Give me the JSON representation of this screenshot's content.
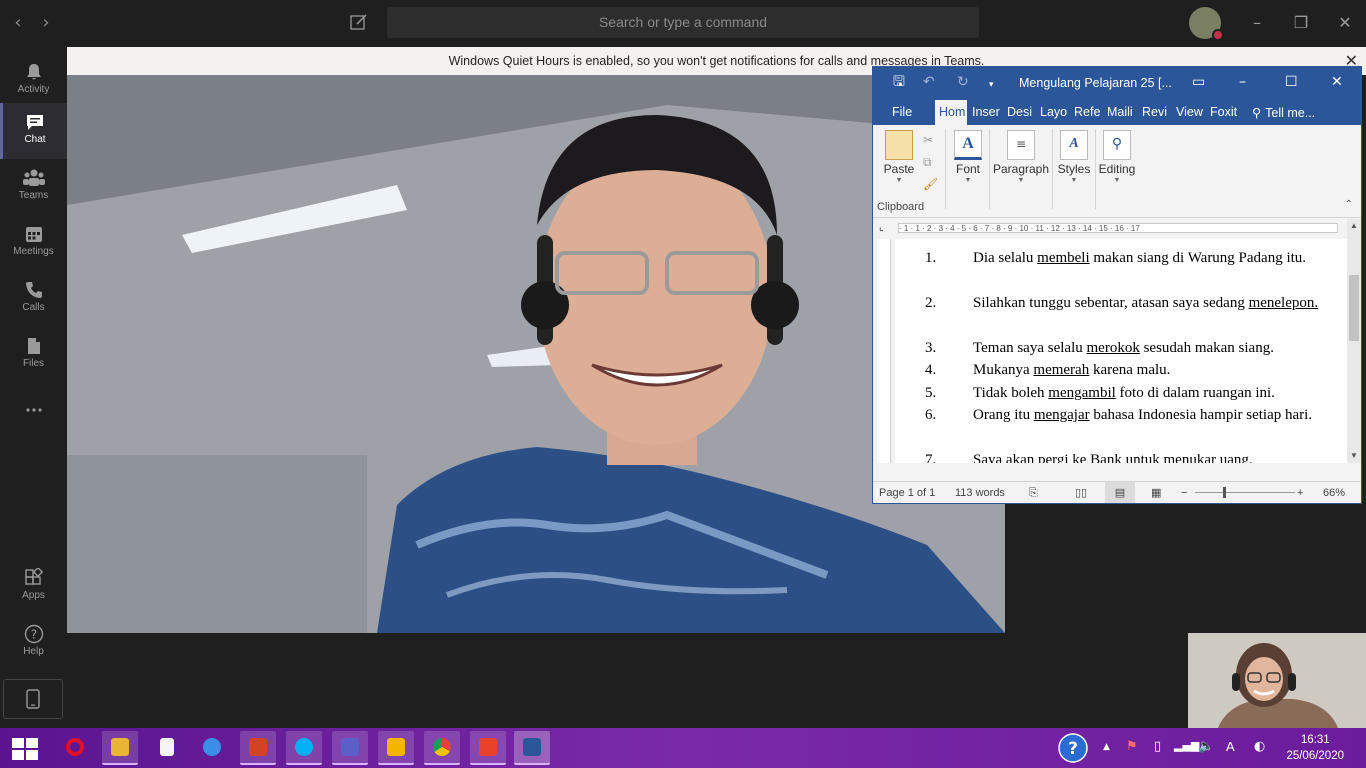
{
  "teams": {
    "search_placeholder": "Search or type a command",
    "notification": "Windows Quiet Hours is enabled, so you won't get notifications for calls and messages in Teams.",
    "rail": [
      {
        "label": "Activity",
        "icon": "bell-icon"
      },
      {
        "label": "Chat",
        "icon": "chat-icon"
      },
      {
        "label": "Teams",
        "icon": "teams-icon"
      },
      {
        "label": "Meetings",
        "icon": "calendar-icon"
      },
      {
        "label": "Calls",
        "icon": "phone-icon"
      },
      {
        "label": "Files",
        "icon": "file-icon"
      },
      {
        "label": "Apps",
        "icon": "apps-icon"
      },
      {
        "label": "Help",
        "icon": "help-icon"
      }
    ],
    "accent": "#6264a7"
  },
  "word": {
    "title": "Mengulang Pelajaran 25 [...",
    "tabs": [
      "File",
      "Hom",
      "Inser",
      "Desi",
      "Layo",
      "Refe",
      "Maili",
      "Revi",
      "View",
      "Foxit",
      "Tell me..."
    ],
    "ribbon": {
      "paste": "Paste",
      "clipboard": "Clipboard",
      "font": "Font",
      "paragraph": "Paragraph",
      "styles": "Styles",
      "editing": "Editing"
    },
    "ruler_ticks": "· 1 · 1 · 2 · 3 · 4 · 5 · 6 · 7 · 8 · 9 · 10 · 11 · 12 · 13 · 14 · 15 · 16 · 17",
    "list": [
      {
        "num": "1.",
        "pre": "Dia selalu ",
        "verb": "membeli",
        "post": " makan siang di Warung Padang itu."
      },
      {
        "num": "2.",
        "pre": "Silahkan tunggu sebentar, atasan saya sedang ",
        "verb": "menelepon.",
        "post": ""
      },
      {
        "num": "3.",
        "pre": "Teman saya selalu ",
        "verb": "merokok",
        "post": " sesudah makan siang."
      },
      {
        "num": "4.",
        "pre": "Mukanya ",
        "verb": "memerah",
        "post": " karena malu."
      },
      {
        "num": "5.",
        "pre": "Tidak boleh ",
        "verb": "mengambil",
        "post": " foto di dalam ruangan ini."
      },
      {
        "num": "6.",
        "pre": "Orang itu ",
        "verb": "mengajar",
        "post": " bahasa Indonesia hampir setiap hari."
      },
      {
        "num": "7.",
        "pre": "Saya akan pergi ke Bank untuk ",
        "verb": "menukar",
        "post": " uang."
      }
    ],
    "status": {
      "page": "Page 1 of 1",
      "words": "113 words",
      "zoom": "66%"
    },
    "accent": "#2b579a"
  },
  "taskbar": {
    "time": "16:31",
    "date": "25/06/2020",
    "ime": "A"
  }
}
